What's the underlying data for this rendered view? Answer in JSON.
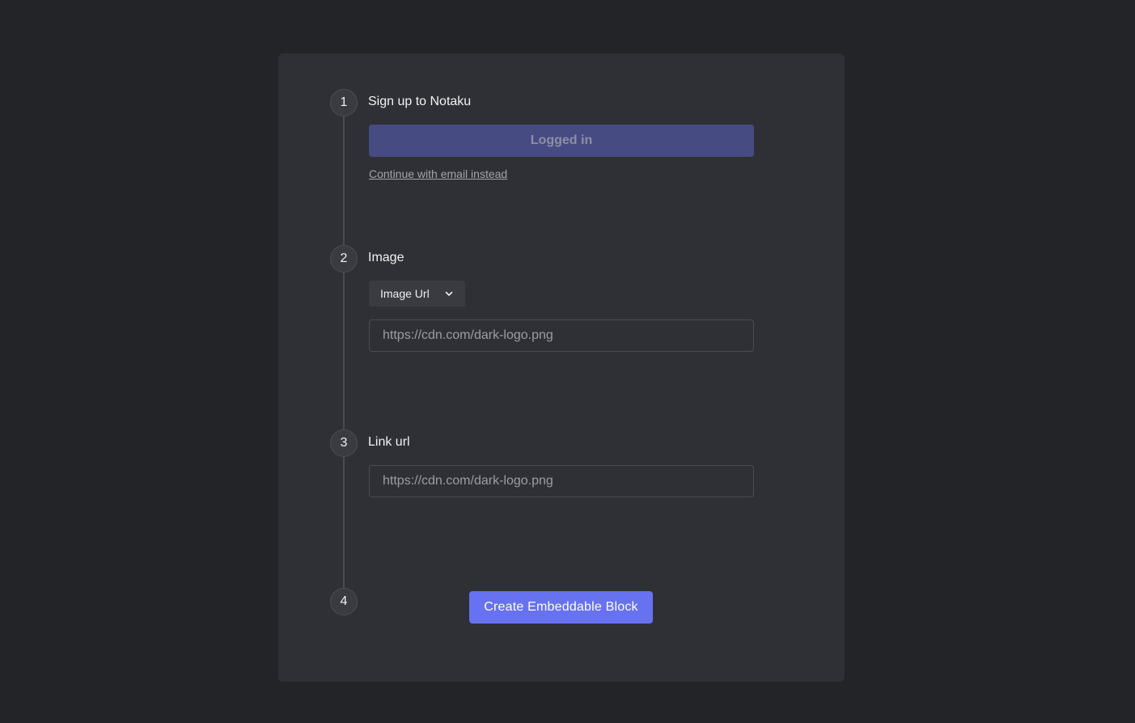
{
  "steps": [
    {
      "number": "1",
      "title": "Sign up to Notaku"
    },
    {
      "number": "2",
      "title": "Image"
    },
    {
      "number": "3",
      "title": "Link url"
    },
    {
      "number": "4",
      "title": ""
    }
  ],
  "signup": {
    "login_button_label": "Logged in",
    "email_link_text": "Continue with email instead"
  },
  "image": {
    "source_select_value": "Image Url",
    "url_input_placeholder": "https://cdn.com/dark-logo.png",
    "url_input_value": ""
  },
  "link": {
    "url_input_placeholder": "https://cdn.com/dark-logo.png",
    "url_input_value": ""
  },
  "submit": {
    "create_button_label": "Create Embeddable Block"
  },
  "colors": {
    "background": "#232428",
    "card": "#2f3036",
    "accent": "#6772f0",
    "disabled_button": "#464b82"
  },
  "icons": {
    "select_chevron": "chevron-down-icon"
  }
}
